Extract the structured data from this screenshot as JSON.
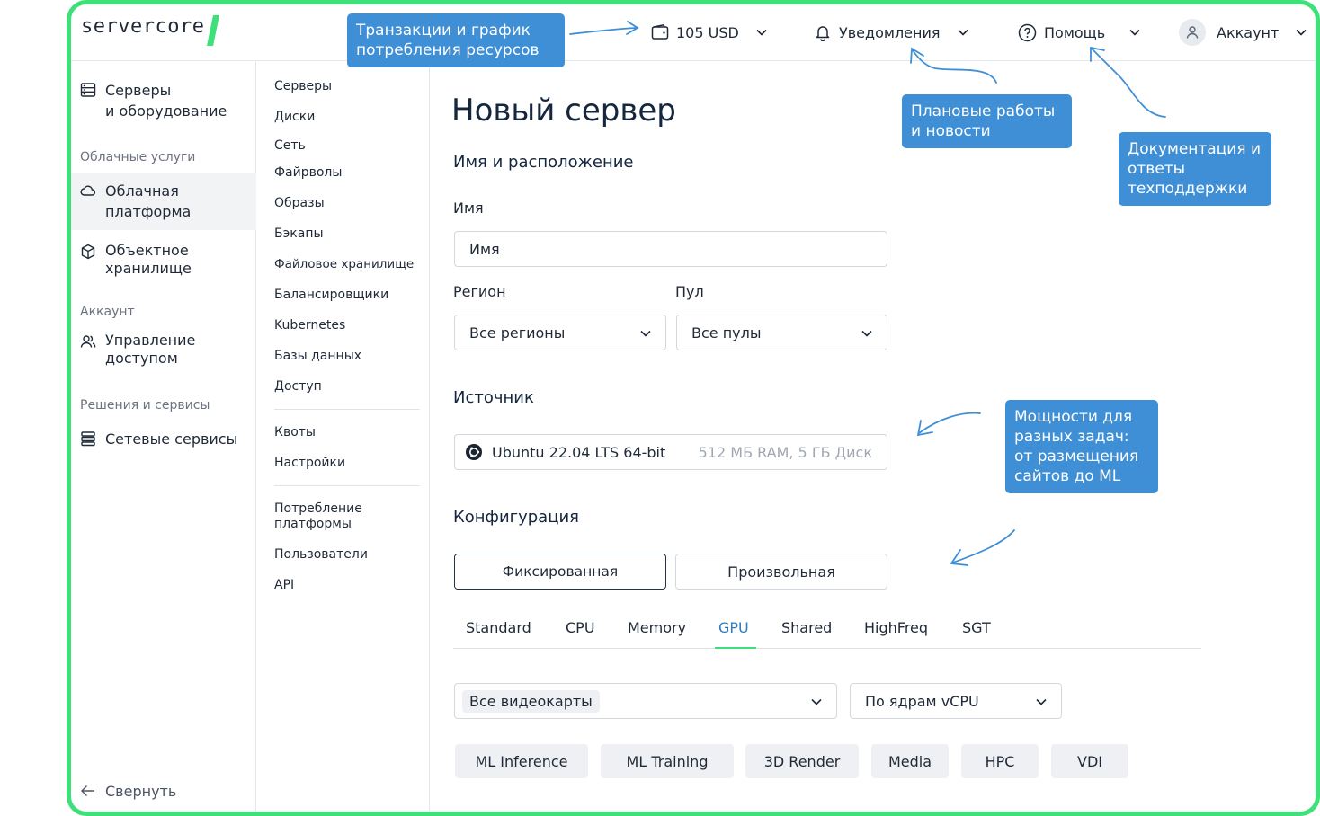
{
  "header": {
    "logo": "servercore",
    "balance": "105 USD",
    "notifications": "Уведомления",
    "help": "Помощь",
    "account": "Аккаунт"
  },
  "sidebar": {
    "items": [
      {
        "label_line1": "Серверы",
        "label_line2": "и оборудование",
        "icon": "server-icon"
      },
      {
        "section": "Облачные услуги"
      },
      {
        "label_line1": "Облачная",
        "label_line2": "платформа",
        "icon": "cloud-icon",
        "active": true
      },
      {
        "label_line1": "Объектное",
        "label_line2": "хранилище",
        "icon": "cube-icon"
      },
      {
        "section": "Аккаунт"
      },
      {
        "label_line1": "Управление",
        "label_line2": "доступом",
        "icon": "users-icon"
      },
      {
        "section": "Решения и сервисы"
      },
      {
        "label_line1": "Сетевые сервисы",
        "icon": "network-icon"
      }
    ],
    "collapse": "Свернуть"
  },
  "subnav": {
    "group1": [
      "Серверы",
      "Диски",
      "Сеть",
      "Файрволы",
      "Образы",
      "Бэкапы",
      "Файловое хранилище",
      "Балансировщики",
      "Kubernetes",
      "Базы данных",
      "Доступ"
    ],
    "group2": [
      "Квоты",
      "Настройки"
    ],
    "group3": [
      "Потребление платформы",
      "Пользователи",
      "API"
    ]
  },
  "main": {
    "title": "Новый сервер",
    "section_name": "Имя и расположение",
    "name_label": "Имя",
    "name_value": "Имя",
    "region_label": "Регион",
    "region_value": "Все регионы",
    "pool_label": "Пул",
    "pool_value": "Все пулы",
    "source_heading": "Источник",
    "source_os": "Ubuntu 22.04 LTS 64-bit",
    "source_spec": "512 МБ RAM, 5 ГБ Диск",
    "config_heading": "Конфигурация",
    "config_fixed": "Фиксированная",
    "config_custom": "Произвольная",
    "tabs": [
      "Standard",
      "CPU",
      "Memory",
      "GPU",
      "Shared",
      "HighFreq",
      "SGT"
    ],
    "active_tab": "GPU",
    "gpu_filter": "Все видеокарты",
    "sort_filter": "По ядрам vCPU",
    "chips": [
      "ML Inference",
      "ML Training",
      "3D Render",
      "Media",
      "HPC",
      "VDI"
    ]
  },
  "callouts": {
    "transactions": "Транзакции и график потребления ресурсов",
    "news": "Плановые работы и новости",
    "docs": "Документация и ответы техподдержки",
    "power": "Мощности для разных задач: от размещения сайтов до ML"
  },
  "colors": {
    "frame": "#3ee07a",
    "callout": "#3f8fd6",
    "active_tab": "#2f7bbd"
  }
}
